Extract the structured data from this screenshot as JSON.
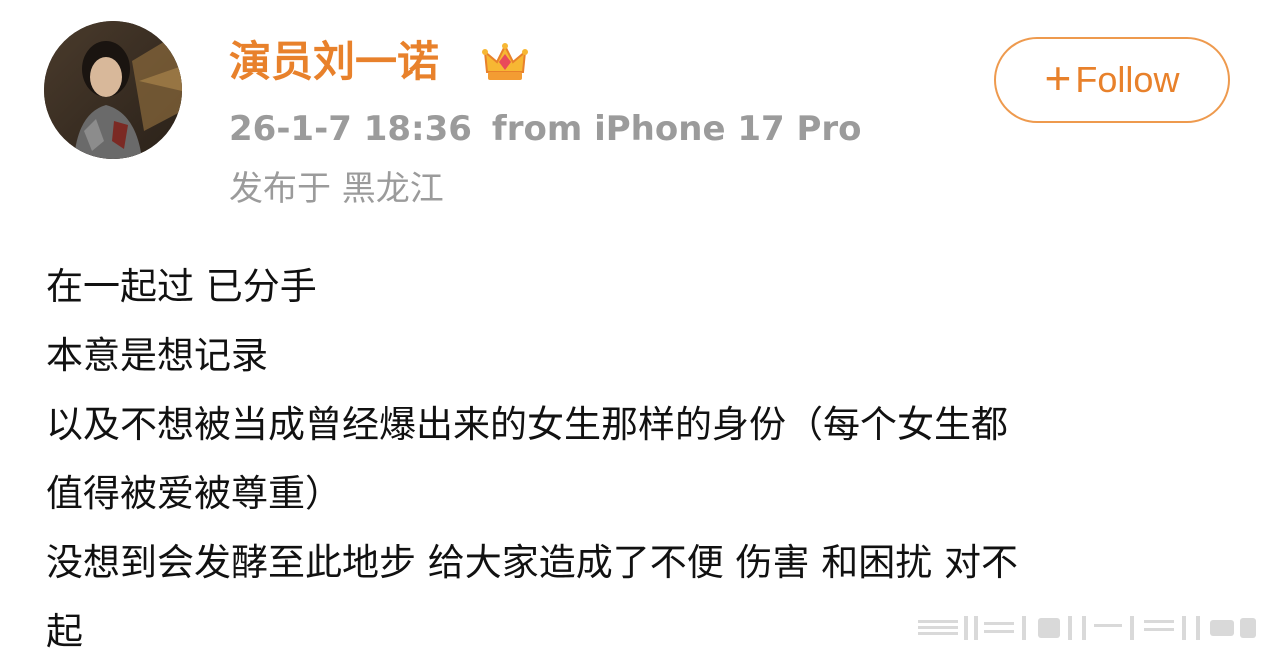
{
  "header": {
    "username": "演员刘一诺",
    "verified_badge_icon": "crown-icon",
    "timestamp": "26-1-7 18:36",
    "source": "from iPhone 17 Pro",
    "location": "发布于 黑龙江",
    "follow_plus": "+",
    "follow_label": "Follow"
  },
  "post": {
    "lines": [
      "在一起过 已分手",
      "本意是想记录",
      "以及不想被当成曾经爆出来的女生那样的身份（每个女生都",
      "值得被爱被尊重）",
      "没想到会发酵至此地步 给大家造成了不便 伤害 和困扰 对不",
      "起"
    ]
  },
  "colors": {
    "accent": "#e8812b",
    "meta_gray": "#9b9b9b",
    "text": "#111111",
    "background": "#ffffff"
  }
}
